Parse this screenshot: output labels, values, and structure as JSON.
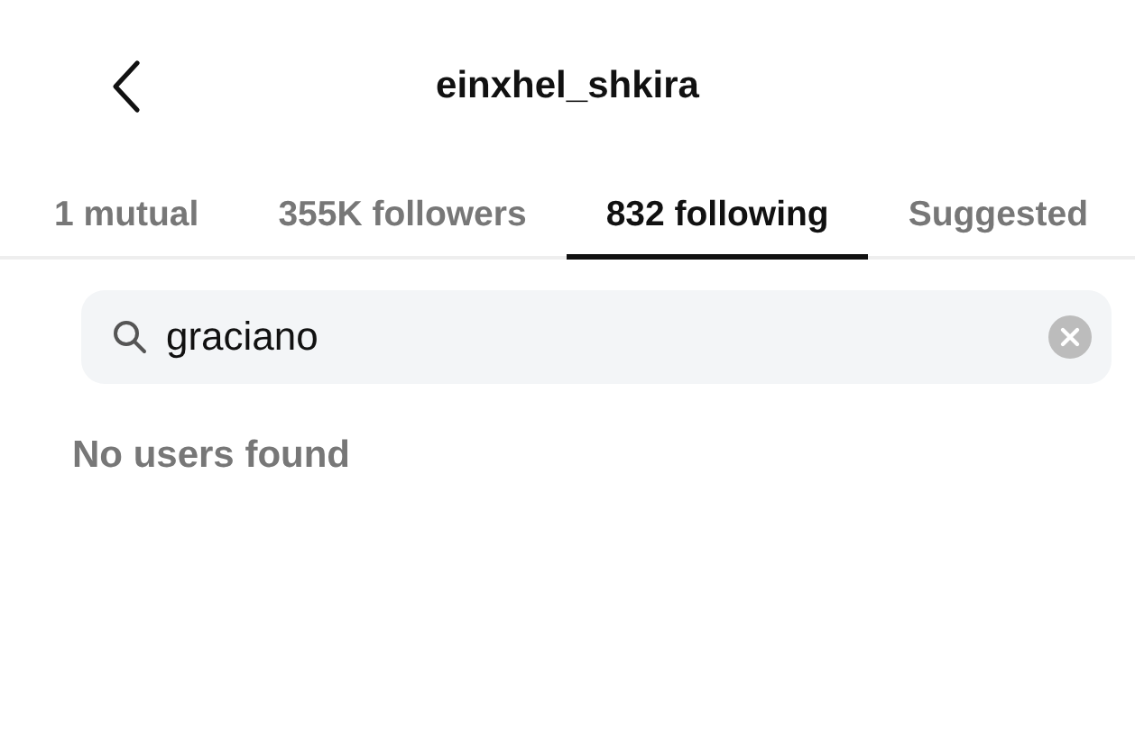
{
  "header": {
    "title": "einxhel_shkira"
  },
  "tabs": [
    {
      "label": "1 mutual",
      "selected": false
    },
    {
      "label": "355K followers",
      "selected": false
    },
    {
      "label": "832 following",
      "selected": true
    },
    {
      "label": "Suggested",
      "selected": false
    }
  ],
  "search": {
    "value": "graciano"
  },
  "message": "No users found"
}
